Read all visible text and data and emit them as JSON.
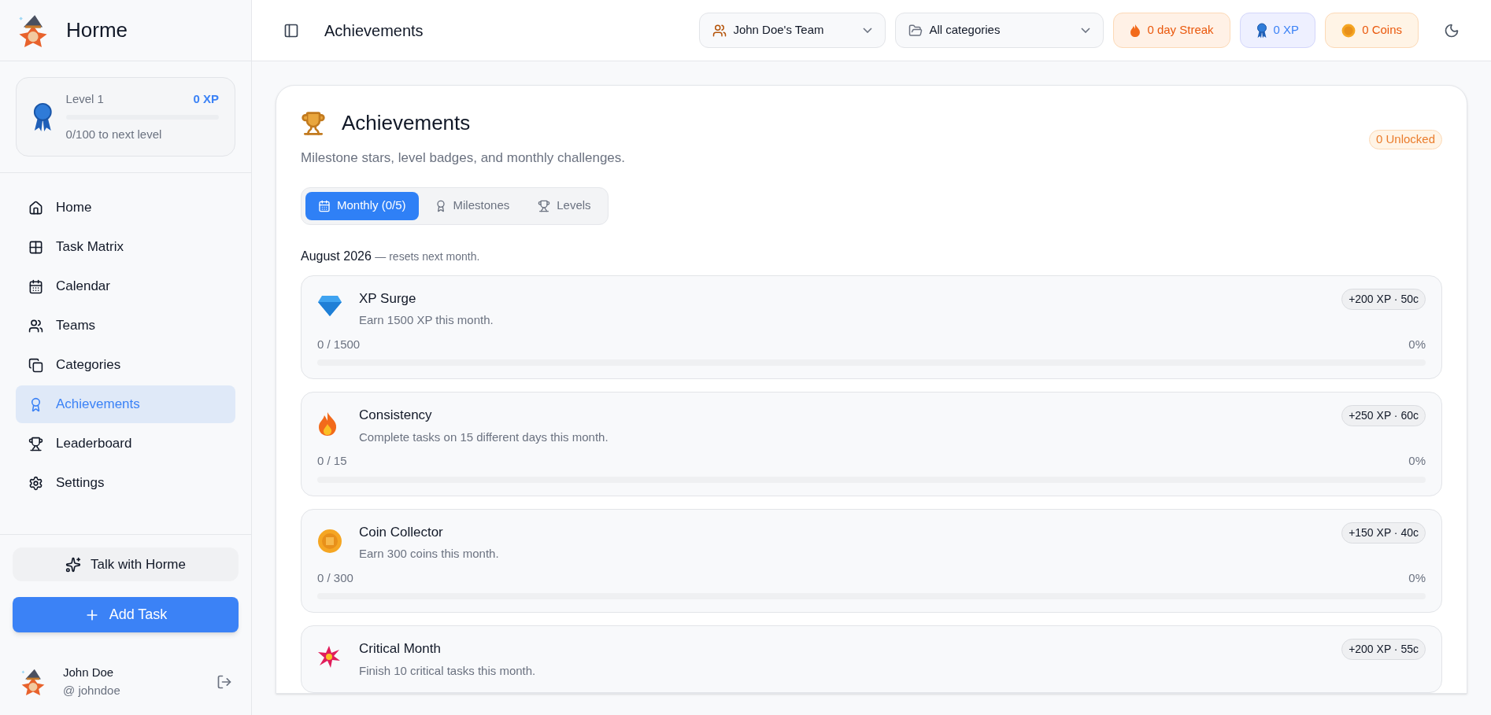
{
  "brand": {
    "name": "Horme"
  },
  "level_card": {
    "label": "Level 1",
    "xp": "0 XP",
    "level": 0,
    "caption": "0/100 to next level"
  },
  "sidebar": {
    "items": [
      {
        "label": "Home",
        "kind": "home",
        "selected": false
      },
      {
        "label": "Task Matrix",
        "kind": "grid",
        "selected": false
      },
      {
        "label": "Calendar",
        "kind": "calendar",
        "selected": false
      },
      {
        "label": "Teams",
        "kind": "users",
        "selected": false
      },
      {
        "label": "Categories",
        "kind": "layers",
        "selected": false
      },
      {
        "label": "Achievements",
        "kind": "award",
        "selected": true
      },
      {
        "label": "Leaderboard",
        "kind": "trophy",
        "selected": false
      },
      {
        "label": "Settings",
        "kind": "settings",
        "selected": false
      }
    ]
  },
  "talk_button": "Talk with Horme",
  "add_button": "Add Task",
  "user": {
    "name": "John Doe",
    "handle": "@ johndoe"
  },
  "header": {
    "title": "Achievements",
    "team": "John Doe's Team",
    "category": "All categories",
    "streak": "0 day Streak",
    "xp": "0 XP",
    "coins": "0 Coins"
  },
  "page": {
    "title": "Achievements",
    "subtitle": "Milestone stars, level badges, and monthly challenges.",
    "unlocked": "0 Unlocked",
    "tabs": [
      {
        "label": "Monthly (0/5)",
        "kind": "calendar",
        "selected": true
      },
      {
        "label": "Milestones",
        "kind": "medal",
        "selected": false
      },
      {
        "label": "Levels",
        "kind": "trophy",
        "selected": false
      }
    ],
    "period": "August 2026",
    "period_note": "— resets next month.",
    "challenges": [
      {
        "kind": "diamond",
        "title": "XP Surge",
        "description": "Earn 1500 XP this month.",
        "reward": "+200 XP · 50c",
        "progress": "0 / 1500",
        "percent": "0%",
        "level": 0
      },
      {
        "kind": "fire",
        "title": "Consistency",
        "description": "Complete tasks on 15 different days this month.",
        "reward": "+250 XP · 60c",
        "progress": "0 / 15",
        "percent": "0%",
        "level": 0
      },
      {
        "kind": "coin",
        "title": "Coin Collector",
        "description": "Earn 300 coins this month.",
        "reward": "+150 XP · 40c",
        "progress": "0 / 300",
        "percent": "0%",
        "level": 0
      },
      {
        "kind": "burst",
        "title": "Critical Month",
        "description": "Finish 10 critical tasks this month.",
        "reward": "+200 XP · 55c"
      }
    ]
  }
}
